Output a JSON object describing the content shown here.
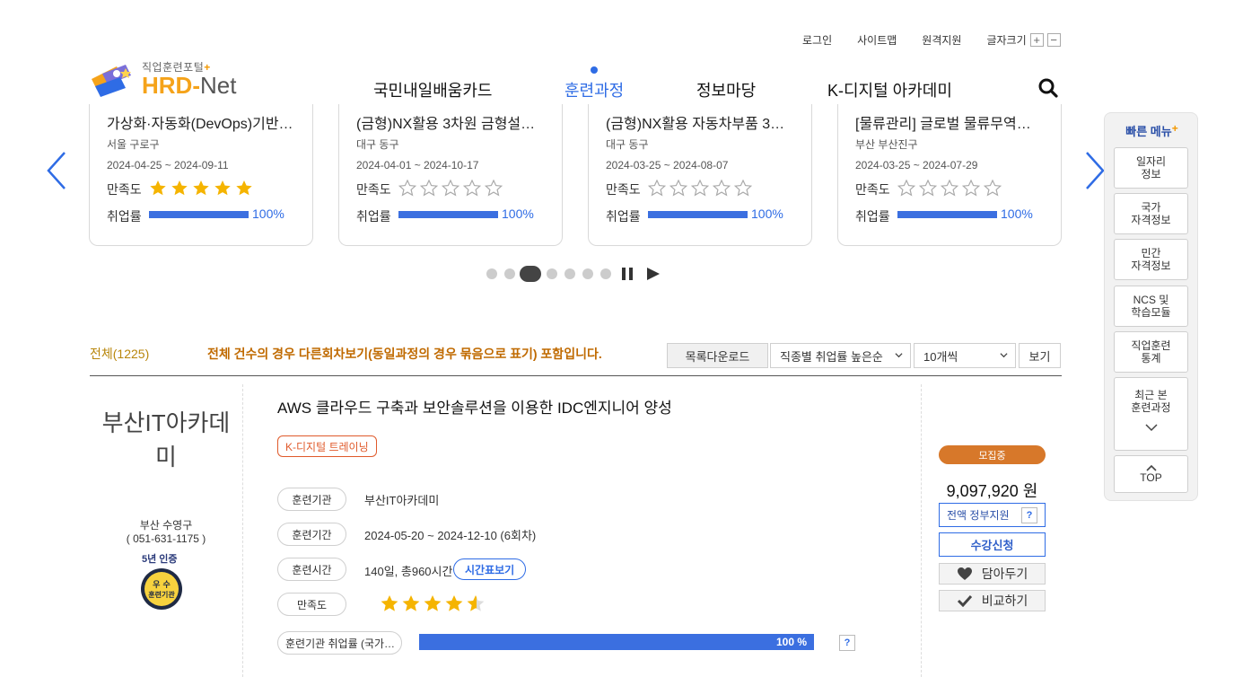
{
  "utility": {
    "login": "로그인",
    "sitemap": "사이트맵",
    "remote": "원격지원",
    "fontsize": "글자크기",
    "plus": "+",
    "minus": "−"
  },
  "logo": {
    "sub": "직업훈련포털",
    "sub_plus": "+",
    "main_a": "HRD-",
    "main_b": "Net"
  },
  "nav": {
    "items": [
      "국민내일배움카드",
      "훈련과정",
      "정보마당",
      "K-디지털 아카데미"
    ],
    "active": "훈련과정"
  },
  "cards": [
    {
      "title": "가상화·자동화(DevOps)기반…",
      "location": "서울 구로구",
      "dates": "2024-04-25 ~ 2024-09-11",
      "satisfaction_label": "만족도",
      "stars": 4.5,
      "employment_label": "취업률",
      "employment": "100%"
    },
    {
      "title": "(금형)NX활용 3차원 금형설…",
      "location": "대구 동구",
      "dates": "2024-04-01 ~ 2024-10-17",
      "satisfaction_label": "만족도",
      "stars": 0,
      "employment_label": "취업률",
      "employment": "100%"
    },
    {
      "title": "(금형)NX활용 자동차부품 3…",
      "location": "대구 동구",
      "dates": "2024-03-25 ~ 2024-08-07",
      "satisfaction_label": "만족도",
      "stars": 0,
      "employment_label": "취업률",
      "employment": "100%"
    },
    {
      "title": "[물류관리] 글로벌 물류무역…",
      "location": "부산 부산진구",
      "dates": "2024-03-25 ~ 2024-07-29",
      "satisfaction_label": "만족도",
      "stars": 0,
      "employment_label": "취업률",
      "employment": "100%"
    }
  ],
  "list": {
    "total": "전체(1225)",
    "notice": "전체 건수의 경우 다른회차보기(동일과정의 경우 묶음으로 표기) 포함입니다.",
    "download": "목록다운로드",
    "sort": "직종별 취업률 높은순",
    "per_page": "10개씩",
    "view": "보기"
  },
  "course": {
    "institution": "부산IT아카데미",
    "region": "부산 수영구",
    "phone": "( 051-631-1175 )",
    "cert": "5년 인증",
    "badge_top": "우 수",
    "badge_bottom": "훈련기관",
    "title": "AWS 클라우드 구축과 보안솔루션을 이용한 IDC엔지니어 양성",
    "tag": "K-디지털 트레이닝",
    "labels": {
      "org": "훈련기관",
      "period": "훈련기간",
      "hours": "훈련시간",
      "satisfaction": "만족도",
      "employment": "훈련기관 취업률 (국가…"
    },
    "org": "부산IT아카데미",
    "period": "2024-05-20 ~ 2024-12-10 (6회차)",
    "hours": "140일, 총960시간",
    "timetable": "시간표보기",
    "stars": 4.5,
    "employment": "100 %",
    "help": "?",
    "status": "모집중",
    "price": "9,097,920 원",
    "gov": "전액 정부지원",
    "apply": "수강신청",
    "wishlist": "담아두기",
    "compare": "비교하기"
  },
  "quick_menu": {
    "title": "빠른 메뉴",
    "plus": "+",
    "items": [
      "일자리\n정보",
      "국가\n자격정보",
      "민간\n자격정보",
      "NCS 및\n학습모듈",
      "직업훈련\n통계",
      "최근 본\n훈련과정"
    ],
    "top": "TOP"
  },
  "colors": {
    "accent": "#2f6ce5",
    "bar": "#3b6fe0",
    "orange": "#d7782a",
    "star": "#f5b400"
  }
}
